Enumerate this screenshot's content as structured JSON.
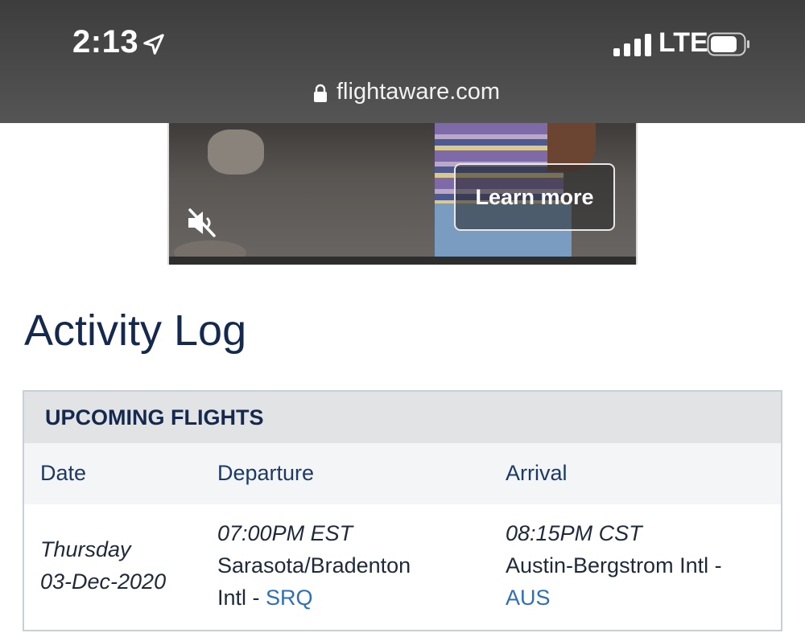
{
  "status_bar": {
    "time": "2:13",
    "network": "LTE",
    "url": "flightaware.com",
    "icons": [
      "location-arrow-icon",
      "signal-bars-icon",
      "battery-icon",
      "lock-icon"
    ]
  },
  "ad": {
    "learn_more_label": "Learn more",
    "icons": [
      "muted-speaker-icon"
    ]
  },
  "page": {
    "title": "Activity Log"
  },
  "upcoming_flights": {
    "heading": "UPCOMING FLIGHTS",
    "columns": [
      "Date",
      "Departure",
      "Arrival"
    ],
    "rows": [
      {
        "day": "Thursday",
        "date": "03-Dec-2020",
        "departure_time": "07:00PM EST",
        "departure_airport_line1": "Sarasota/Bradenton",
        "departure_airport_line2": "Intl - ",
        "departure_code": "SRQ",
        "arrival_time": "08:15PM CST",
        "arrival_airport_line1": "Austin-Bergstrom Intl -",
        "arrival_code": "AUS"
      }
    ]
  },
  "colors": {
    "title": "#14294d",
    "link": "#2f6fb4",
    "header_bg": "#e2e3e5"
  }
}
